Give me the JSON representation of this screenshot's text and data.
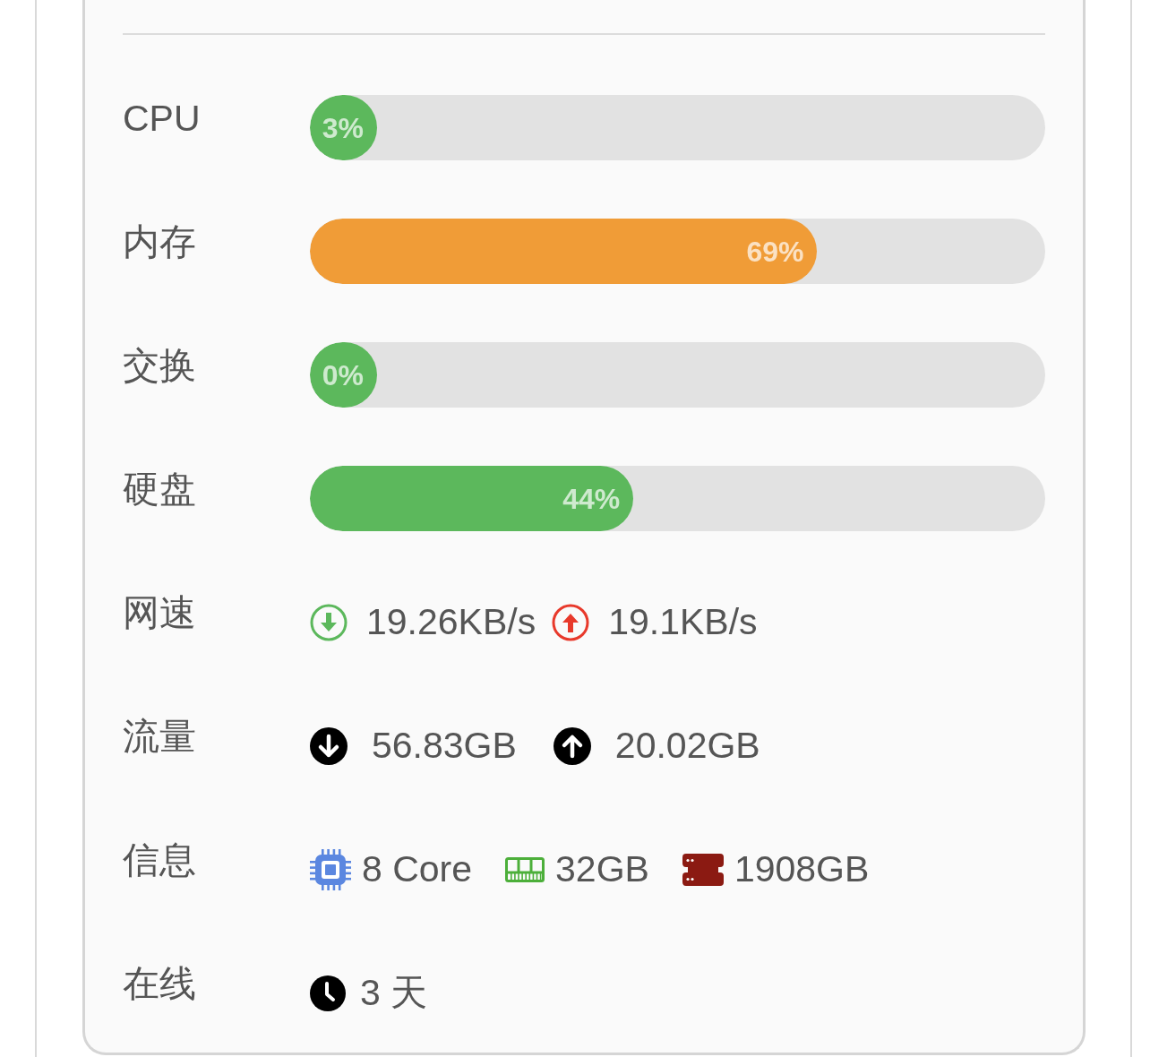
{
  "stats": [
    {
      "kind": "bar",
      "label": "CPU",
      "level": 0.03,
      "reading": "3%",
      "color": "#5cb85c"
    },
    {
      "kind": "bar",
      "label": "内存",
      "level": 0.69,
      "reading": "69%",
      "color": "#f09c37"
    },
    {
      "kind": "bar",
      "label": "交换",
      "level": 0,
      "reading": "0%",
      "color": "#5cb85c"
    },
    {
      "kind": "bar",
      "label": "硬盘",
      "level": 0.44,
      "reading": "44%",
      "color": "#5cb85c"
    },
    {
      "kind": "speed",
      "label": "网速",
      "items": [
        {
          "kind": "down",
          "value": "19.26KB/s"
        },
        {
          "kind": "up",
          "value": "19.1KB/s"
        }
      ]
    },
    {
      "kind": "traffic",
      "label": "流量",
      "items": [
        {
          "kind": "down",
          "value": "56.83GB"
        },
        {
          "kind": "up",
          "value": "20.02GB"
        }
      ]
    },
    {
      "kind": "specs",
      "label": "信息",
      "items": [
        {
          "kind": "cpu",
          "value": "8 Core"
        },
        {
          "kind": "ram",
          "value": "32GB"
        },
        {
          "kind": "disk",
          "value": "1908GB"
        }
      ]
    },
    {
      "kind": "uptime",
      "label": "在线",
      "items": [
        {
          "kind": "clock",
          "value": "3 天"
        }
      ]
    }
  ]
}
